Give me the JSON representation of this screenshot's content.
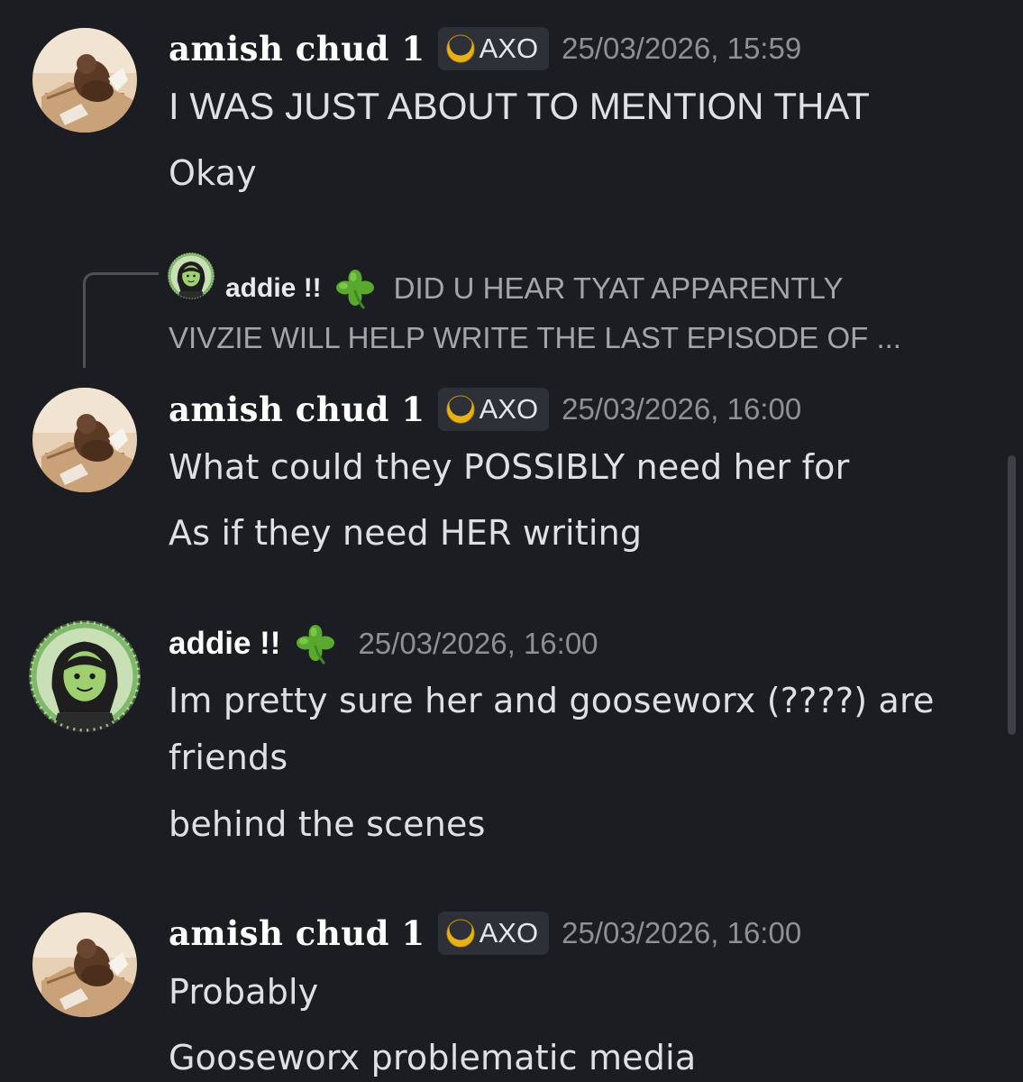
{
  "colors": {
    "background": "#1c1d22",
    "username": "#ffffff",
    "message_text": "#dfe0e4",
    "timestamp": "#8e9097",
    "tag_background": "#2e3038",
    "tag_icon": "#e8b11a"
  },
  "messages": [
    {
      "username": "amish chud 1",
      "tag": "AXO",
      "tag_icon": "crescent-moon-icon",
      "timestamp": "25/03/2026, 15:59",
      "lines": [
        "I WAS JUST ABOUT TO MENTION THAT",
        "Okay"
      ]
    },
    {
      "reply": {
        "username": "addie !!",
        "emoji": "four-leaf-clover-icon",
        "text_line1": "DID U HEAR TYAT APPARENTLY",
        "text_line2": "VIVZIE WILL HELP WRITE THE LAST EPISODE OF ..."
      },
      "username": "amish chud 1",
      "tag": "AXO",
      "tag_icon": "crescent-moon-icon",
      "timestamp": "25/03/2026, 16:00",
      "lines": [
        "What could they POSSIBLY need her for",
        "As if they need HER writing"
      ]
    },
    {
      "username": "addie !!",
      "emoji": "four-leaf-clover-icon",
      "timestamp": "25/03/2026, 16:00",
      "lines": [
        "Im pretty sure her and gooseworx (????) are",
        "friends",
        "behind the scenes"
      ]
    },
    {
      "username": "amish chud 1",
      "tag": "AXO",
      "tag_icon": "crescent-moon-icon",
      "timestamp": "25/03/2026, 16:00",
      "lines": [
        "Probably",
        "Gooseworx problematic media"
      ]
    }
  ]
}
